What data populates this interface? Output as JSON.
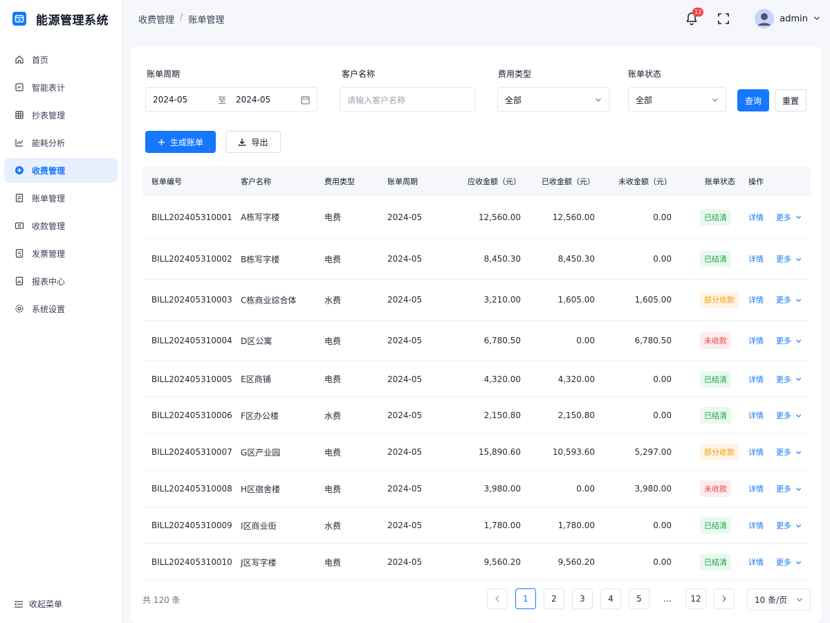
{
  "app": {
    "title": "能源管理系统"
  },
  "sidebar": {
    "items": [
      {
        "label": "首页",
        "icon": "home-icon"
      },
      {
        "label": "智能表计",
        "icon": "meter-icon"
      },
      {
        "label": "抄表管理",
        "icon": "grid-icon"
      },
      {
        "label": "能耗分析",
        "icon": "chart-icon"
      },
      {
        "label": "收费管理",
        "icon": "billing-icon",
        "active": true
      },
      {
        "label": "账单管理",
        "icon": "bill-icon"
      },
      {
        "label": "收款管理",
        "icon": "payment-icon"
      },
      {
        "label": "发票管理",
        "icon": "invoice-icon"
      },
      {
        "label": "报表中心",
        "icon": "report-icon"
      },
      {
        "label": "系统设置",
        "icon": "gear-icon"
      }
    ],
    "collapse_label": "收起菜单"
  },
  "header": {
    "breadcrumb": [
      "收费管理",
      "账单管理"
    ],
    "notification_count": "12",
    "username": "admin"
  },
  "filters": {
    "period_label": "账单周期",
    "period_start": "2024-05",
    "period_to": "至",
    "period_end": "2024-05",
    "customer_label": "客户名称",
    "customer_placeholder": "请输入客户名称",
    "fee_type_label": "费用类型",
    "fee_type_value": "全部",
    "status_label": "账单状态",
    "status_value": "全部",
    "query_label": "查询",
    "reset_label": "重置"
  },
  "toolbar": {
    "generate_label": "生成账单",
    "export_label": "导出"
  },
  "table": {
    "headers": [
      "账单编号",
      "客户名称",
      "费用类型",
      "账单周期",
      "应收金额（元）",
      "已收金额（元）",
      "未收金额（元）",
      "账单状态",
      "操作"
    ],
    "detail_label": "详情",
    "more_label": "更多",
    "rows": [
      {
        "id": "BILL202405310001",
        "customer": "A栋写字楼",
        "type": "电费",
        "period": "2024-05",
        "due": "12,560.00",
        "paid": "12,560.00",
        "unpaid": "0.00",
        "status": "已结清",
        "status_kind": "done"
      },
      {
        "id": "BILL202405310002",
        "customer": "B栋写字楼",
        "type": "电费",
        "period": "2024-05",
        "due": "8,450.30",
        "paid": "8,450.30",
        "unpaid": "0.00",
        "status": "已结清",
        "status_kind": "done"
      },
      {
        "id": "BILL202405310003",
        "customer": "C栋商业综合体",
        "type": "水费",
        "period": "2024-05",
        "due": "3,210.00",
        "paid": "1,605.00",
        "unpaid": "1,605.00",
        "status": "部分收款",
        "status_kind": "part"
      },
      {
        "id": "BILL202405310004",
        "customer": "D区公寓",
        "type": "电费",
        "period": "2024-05",
        "due": "6,780.50",
        "paid": "0.00",
        "unpaid": "6,780.50",
        "status": "未收款",
        "status_kind": "none"
      },
      {
        "id": "BILL202405310005",
        "customer": "E区商铺",
        "type": "电费",
        "period": "2024-05",
        "due": "4,320.00",
        "paid": "4,320.00",
        "unpaid": "0.00",
        "status": "已结清",
        "status_kind": "done"
      },
      {
        "id": "BILL202405310006",
        "customer": "F区办公楼",
        "type": "水费",
        "period": "2024-05",
        "due": "2,150.80",
        "paid": "2,150.80",
        "unpaid": "0.00",
        "status": "已结清",
        "status_kind": "done"
      },
      {
        "id": "BILL202405310007",
        "customer": "G区产业园",
        "type": "电费",
        "period": "2024-05",
        "due": "15,890.60",
        "paid": "10,593.60",
        "unpaid": "5,297.00",
        "status": "部分收款",
        "status_kind": "part"
      },
      {
        "id": "BILL202405310008",
        "customer": "H区宿舍楼",
        "type": "电费",
        "period": "2024-05",
        "due": "3,980.00",
        "paid": "0.00",
        "unpaid": "3,980.00",
        "status": "未收款",
        "status_kind": "none"
      },
      {
        "id": "BILL202405310009",
        "customer": "I区商业街",
        "type": "水费",
        "period": "2024-05",
        "due": "1,780.00",
        "paid": "1,780.00",
        "unpaid": "0.00",
        "status": "已结清",
        "status_kind": "done"
      },
      {
        "id": "BILL202405310010",
        "customer": "J区写字楼",
        "type": "电费",
        "period": "2024-05",
        "due": "9,560.20",
        "paid": "9,560.20",
        "unpaid": "0.00",
        "status": "已结清",
        "status_kind": "done"
      }
    ]
  },
  "pagination": {
    "total_text": "共 120 条",
    "pages": [
      "1",
      "2",
      "3",
      "4",
      "5",
      "…",
      "12"
    ],
    "current": "1",
    "page_size": "10 条/页"
  },
  "colors": {
    "primary": "#1677ff",
    "done": "#16a34a",
    "part": "#f59e0b",
    "none": "#ef4444"
  }
}
